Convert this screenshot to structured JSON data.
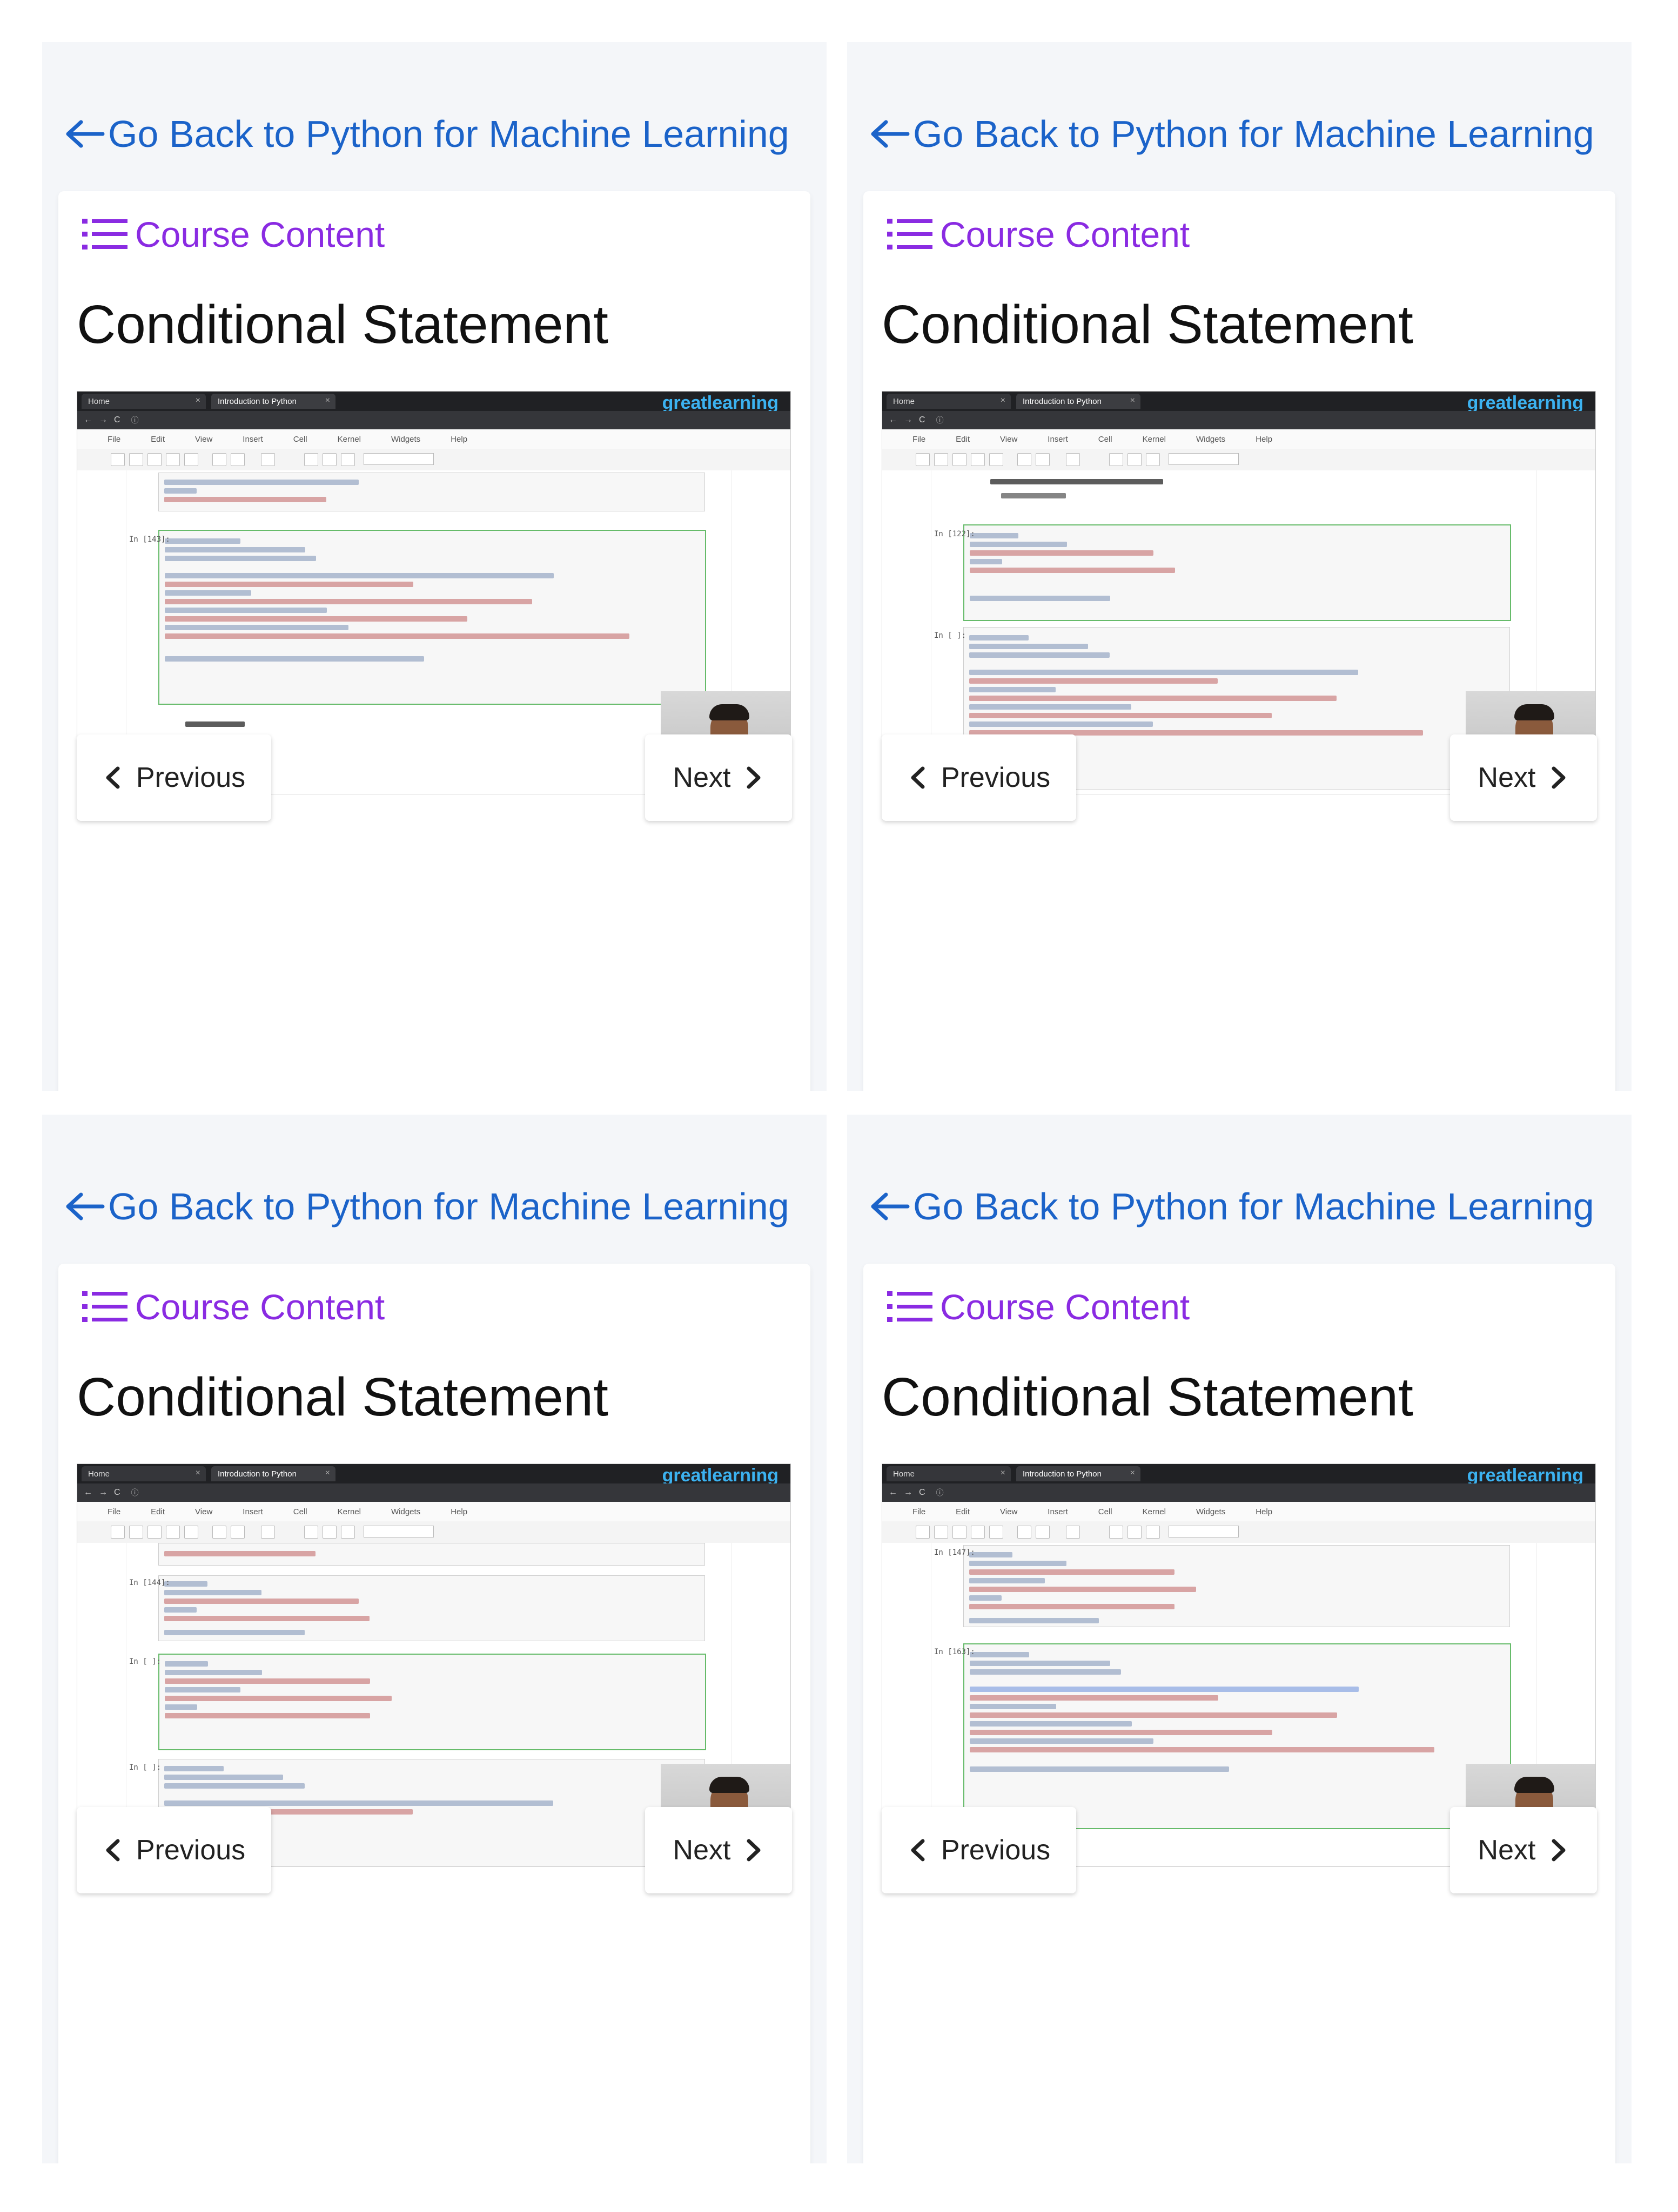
{
  "panels": [
    {
      "back_link": "Go Back to Python for Machine Learning",
      "course_content": "Course Content",
      "lesson_title": "Conditional Statement",
      "video": {
        "tabs": [
          "Home",
          "Introduction to Python"
        ],
        "brand": "greatlearning",
        "menu": [
          "File",
          "Edit",
          "View",
          "Insert",
          "Cell",
          "Kernel",
          "Widgets",
          "Help"
        ]
      },
      "previous_label": "Previous",
      "next_label": "Next"
    },
    {
      "back_link": "Go Back to Python for Machine Learning",
      "course_content": "Course Content",
      "lesson_title": "Conditional Statement",
      "video": {
        "tabs": [
          "Home",
          "Introduction to Python"
        ],
        "brand": "greatlearning",
        "menu": [
          "File",
          "Edit",
          "View",
          "Insert",
          "Cell",
          "Kernel",
          "Widgets",
          "Help"
        ]
      },
      "previous_label": "Previous",
      "next_label": "Next"
    },
    {
      "back_link": "Go Back to Python for Machine Learning",
      "course_content": "Course Content",
      "lesson_title": "Conditional Statement",
      "video": {
        "tabs": [
          "Home",
          "Introduction to Python"
        ],
        "brand": "greatlearning",
        "menu": [
          "File",
          "Edit",
          "View",
          "Insert",
          "Cell",
          "Kernel",
          "Widgets",
          "Help"
        ]
      },
      "previous_label": "Previous",
      "next_label": "Next"
    },
    {
      "back_link": "Go Back to Python for Machine Learning",
      "course_content": "Course Content",
      "lesson_title": "Conditional Statement",
      "video": {
        "tabs": [
          "Home",
          "Introduction to Python"
        ],
        "brand": "greatlearning",
        "menu": [
          "File",
          "Edit",
          "View",
          "Insert",
          "Cell",
          "Kernel",
          "Widgets",
          "Help"
        ]
      },
      "previous_label": "Previous",
      "next_label": "Next"
    }
  ],
  "colors": {
    "link_blue": "#1b63c9",
    "course_purple": "#8a2be2",
    "panel_bg": "#f4f6f9",
    "brand_blue": "#3cb2f0"
  },
  "icons": [
    "arrow-left-icon",
    "list-icon",
    "chevron-left-icon",
    "chevron-right-icon"
  ]
}
